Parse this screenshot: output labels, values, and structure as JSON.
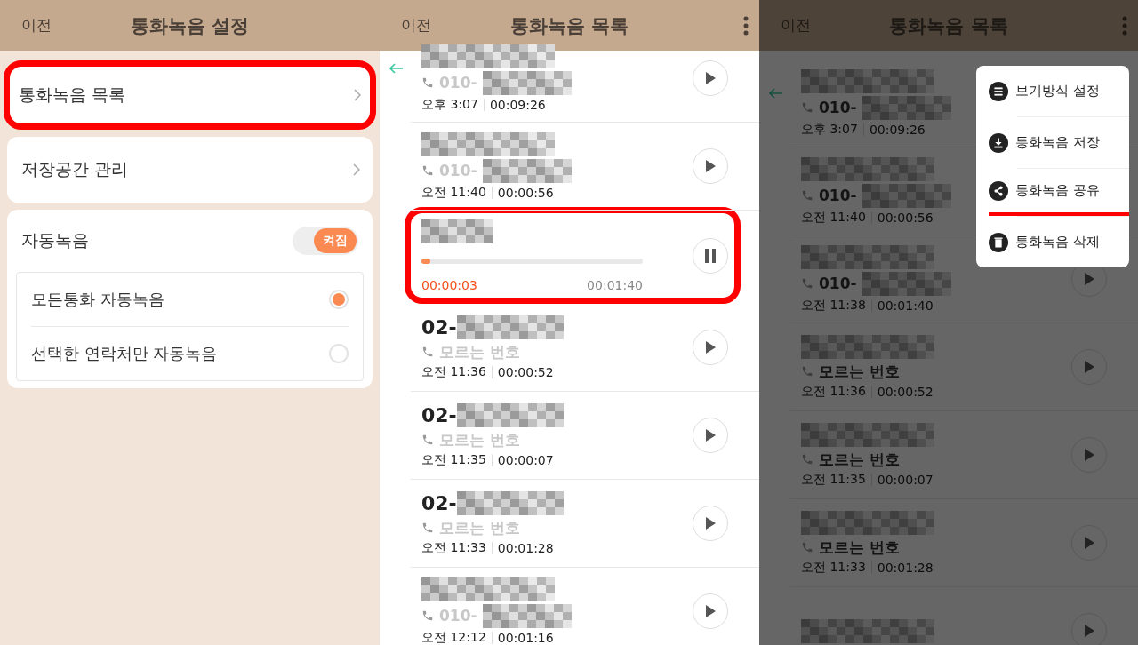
{
  "panels": [
    {
      "kind": "settings",
      "back": "이전",
      "title": "통화녹음 설정",
      "items": [
        {
          "label": "통화녹음 목록",
          "highlighted": true
        },
        {
          "label": "저장공간 관리",
          "highlighted": false
        }
      ],
      "auto": {
        "label": "자동녹음",
        "toggle": "켜짐",
        "on": true,
        "options": [
          {
            "label": "모든통화 자동녹음",
            "selected": true
          },
          {
            "label": "선택한 연락처만 자동녹음",
            "selected": false
          }
        ]
      }
    },
    {
      "kind": "list",
      "back": "이전",
      "title": "통화녹음 목록",
      "dimmed": false,
      "rows": [
        {
          "kind": "recording",
          "phone": "010-",
          "time": "오후 3:07",
          "duration": "00:09:26",
          "back_arrow": true
        },
        {
          "kind": "recording",
          "phone": "010-",
          "time": "오전 11:40",
          "duration": "00:00:56"
        },
        {
          "kind": "playing",
          "highlighted": true,
          "level": 0.03,
          "elapsed": "00:00:03",
          "total": "00:01:40"
        },
        {
          "kind": "recording",
          "name_prefix": "02-",
          "phone": "모르는 번호",
          "time": "오전 11:36",
          "duration": "00:00:52"
        },
        {
          "kind": "recording",
          "name_prefix": "02-",
          "phone": "모르는 번호",
          "time": "오전 11:35",
          "duration": "00:00:07"
        },
        {
          "kind": "recording",
          "name_prefix": "02-",
          "phone": "모르는 번호",
          "time": "오전 11:33",
          "duration": "00:01:28"
        },
        {
          "kind": "recording",
          "phone": "010-",
          "time": "오전 12:12",
          "duration": "00:01:16"
        }
      ]
    },
    {
      "kind": "list",
      "back": "이전",
      "title": "통화녹음 목록",
      "dimmed": true,
      "rows": [
        {
          "kind": "recording",
          "phone": "010-",
          "time": "오후 3:07",
          "duration": "00:09:26",
          "back_arrow": true
        },
        {
          "kind": "recording",
          "phone": "010-",
          "time": "오전 11:40",
          "duration": "00:00:56"
        },
        {
          "kind": "recording",
          "phone": "010-",
          "time": "오전 11:38",
          "duration": "00:01:40"
        },
        {
          "kind": "recording",
          "phone": "모르는 번호",
          "time": "오전 11:36",
          "duration": "00:00:52"
        },
        {
          "kind": "recording",
          "phone": "모르는 번호",
          "time": "오전 11:35",
          "duration": "00:00:07"
        },
        {
          "kind": "recording",
          "phone": "모르는 번호",
          "time": "오전 11:33",
          "duration": "00:01:28"
        },
        {
          "kind": "recording"
        }
      ],
      "menu": [
        {
          "kind": "view",
          "label": "보기방식 설정",
          "highlighted": false
        },
        {
          "kind": "download",
          "label": "통화녹음 저장",
          "highlighted": false
        },
        {
          "kind": "share",
          "label": "통화녹음 공유",
          "highlighted": true
        },
        {
          "kind": "trash",
          "label": "통화녹음 삭제",
          "highlighted": false
        }
      ]
    }
  ]
}
